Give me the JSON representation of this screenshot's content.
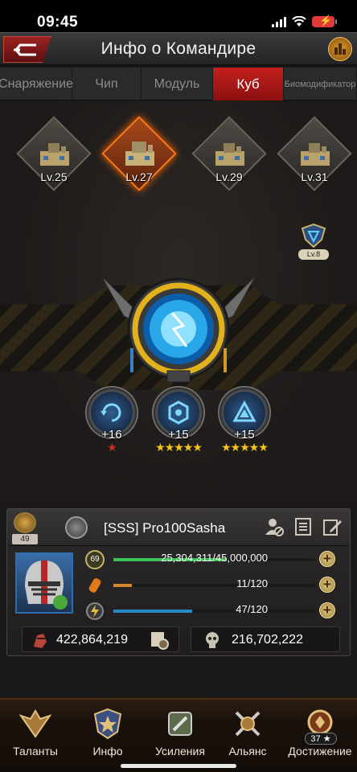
{
  "status": {
    "time": "09:45"
  },
  "header": {
    "title": "Инфо о Командире"
  },
  "tabs": [
    {
      "label": "Снаряжение"
    },
    {
      "label": "Чип"
    },
    {
      "label": "Модуль"
    },
    {
      "label": "Куб"
    },
    {
      "label": "Биомодификатор"
    }
  ],
  "active_tab": "Куб",
  "bases": [
    {
      "level": "Lv.25"
    },
    {
      "level": "Lv.27"
    },
    {
      "level": "Lv.29"
    },
    {
      "level": "Lv.31"
    }
  ],
  "selected_base": "Lv.27",
  "side_badge": {
    "level": "Lv.8"
  },
  "modules": [
    {
      "level": "+16",
      "stars": "★",
      "star_color": "#d42a20"
    },
    {
      "level": "+15",
      "stars": "★★★★★",
      "star_color": "#f5c518"
    },
    {
      "level": "+15",
      "stars": "★★★★★",
      "star_color": "#f5c518"
    }
  ],
  "commander": {
    "rank": "49",
    "name": "[SSS]   Pro100Sasha",
    "level_badge": "69",
    "exp": {
      "text": "25,304,311/45,000,000",
      "fraction": 0.5623,
      "color": "#3bbf57"
    },
    "stamina": {
      "text": "11/120",
      "fraction": 0.0917,
      "color": "#d7842a"
    },
    "energy": {
      "text": "47/120",
      "fraction": 0.3917,
      "color": "#2a87c9"
    },
    "power": "422,864,219",
    "kills": "216,702,222"
  },
  "bottom_nav": [
    {
      "label": "Таланты"
    },
    {
      "label": "Инфо"
    },
    {
      "label": "Усиления"
    },
    {
      "label": "Альянс"
    },
    {
      "label": "Достижение",
      "badge": "37 ★"
    }
  ]
}
